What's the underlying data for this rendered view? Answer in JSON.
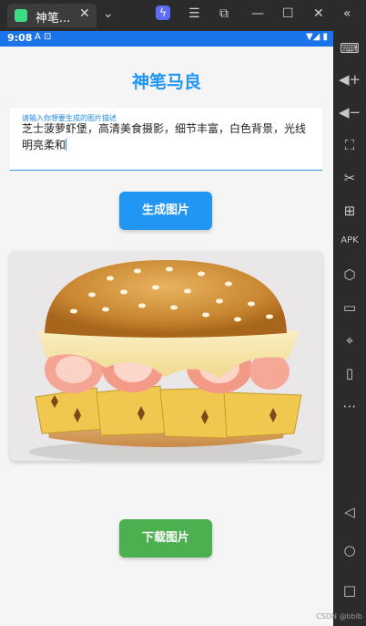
{
  "emulator": {
    "tab_title": "神笔...",
    "tab_close": "✕",
    "app_icon": "android-icon",
    "toolbar_icons": [
      "chevron-down-icon",
      "bolt-icon",
      "menu-icon",
      "resize-icon",
      "minimize-icon",
      "maximize-icon",
      "close-icon",
      "double-chevron-left-icon"
    ]
  },
  "status_bar": {
    "time": "9:08",
    "misc": "A  ⊡",
    "right": "▼◢ ▮"
  },
  "app": {
    "title": "神笔马良",
    "prompt": {
      "label": "请输入你想要生成的图片描述",
      "value": "芝士菠萝虾堡，高清美食摄影，细节丰富，白色背景，光线明亮柔和"
    },
    "generate_button": "生成图片",
    "download_button": "下载图片",
    "image_alt": "shrimp-pineapple-cheese-burger-image"
  },
  "sidebar_icons": [
    "keyboard-icon",
    "volume-up-icon",
    "volume-down-icon",
    "screenshot-icon",
    "scissors-icon",
    "add-window-icon",
    "apk-icon",
    "settings-hex-icon",
    "folder-icon",
    "location-icon",
    "shake-icon",
    "more-icon",
    "back-icon",
    "home-icon",
    "recent-apps-icon"
  ],
  "watermark": "CSDN @bblb",
  "colors": {
    "accent": "#2196f3",
    "download": "#4caf50",
    "status_bar": "#1a73e8"
  }
}
